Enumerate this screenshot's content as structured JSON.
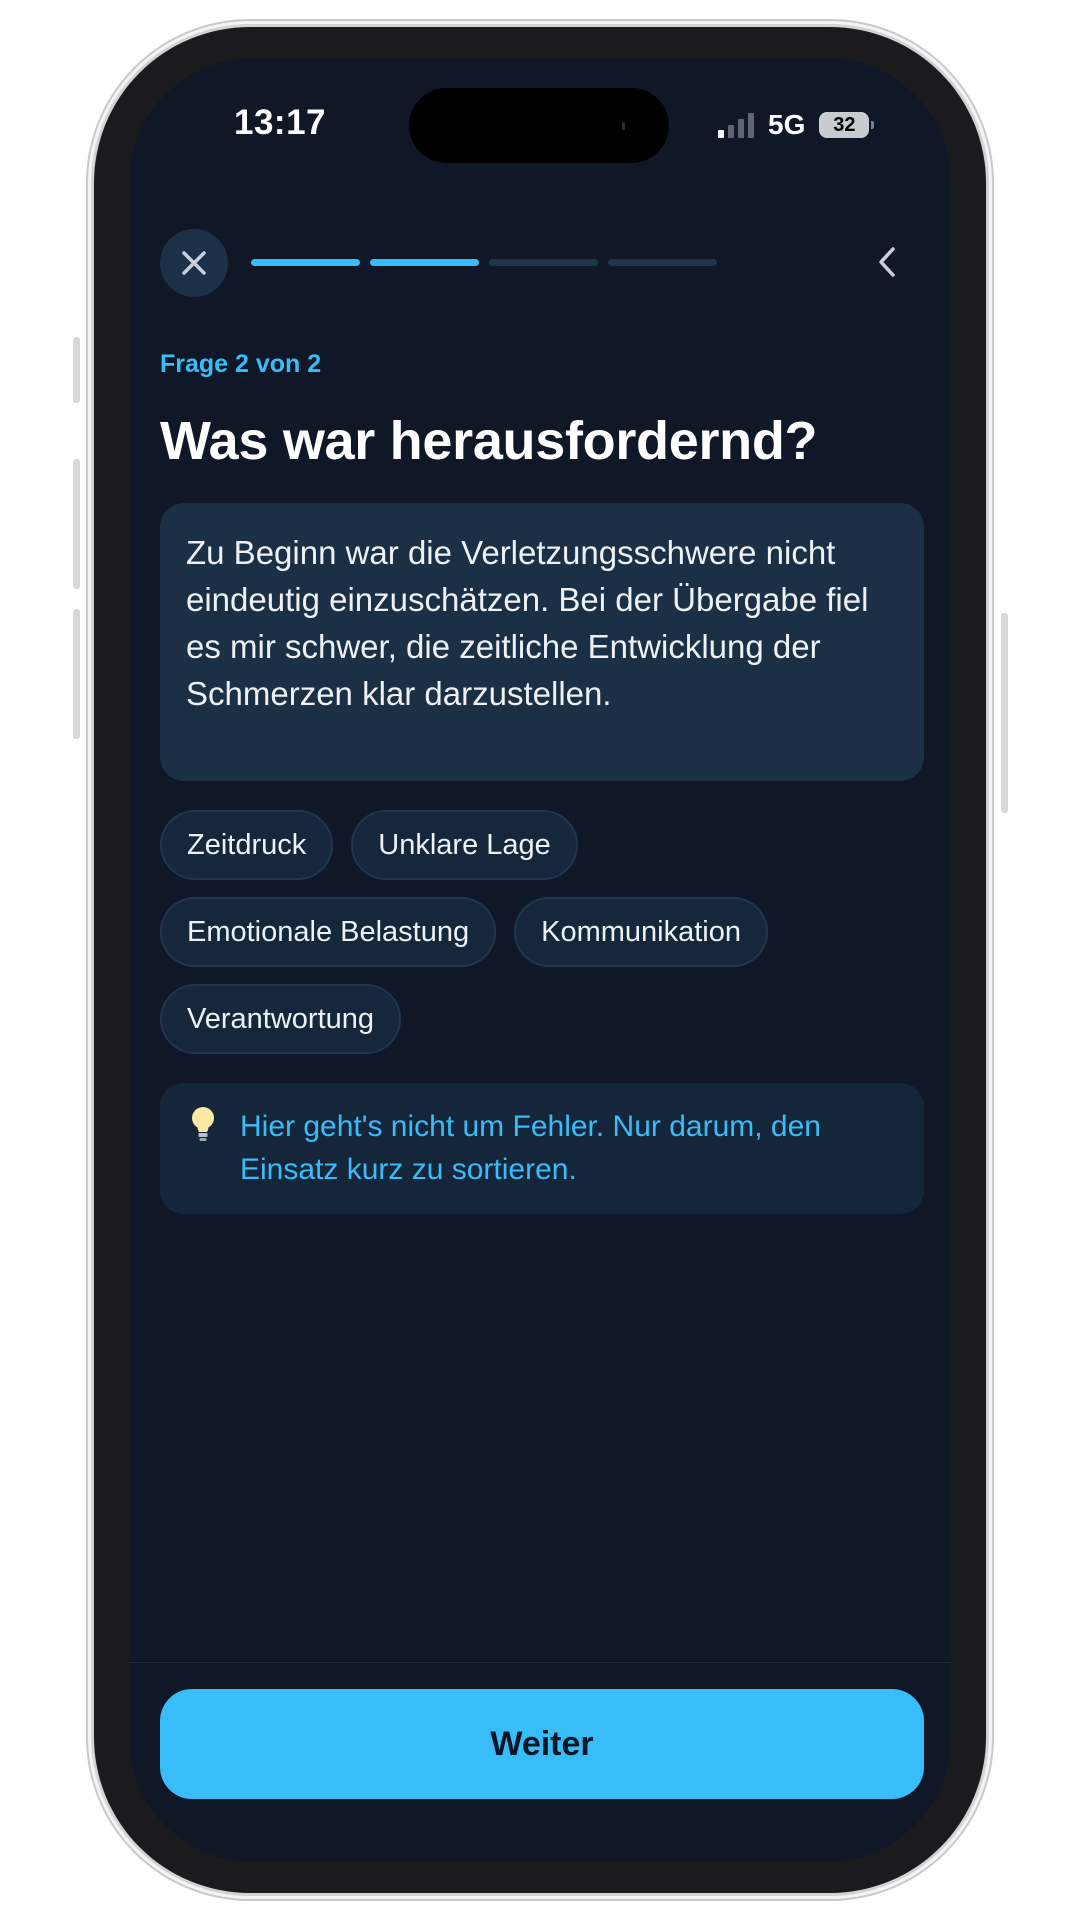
{
  "status_bar": {
    "time": "13:17",
    "network": "5G",
    "battery": "32"
  },
  "header": {
    "progress": {
      "total_segments": 4,
      "completed_segments": 2
    }
  },
  "question": {
    "step_label": "Frage 2 von 2",
    "title": "Was war herausfordernd?",
    "answer_text": "Zu Beginn war die Verletzungsschwere nicht eindeutig einzuschätzen. Bei der Übergabe fiel es mir schwer, die zeitliche Entwicklung der Schmerzen klar darzustellen."
  },
  "chips": [
    {
      "label": "Zeitdruck"
    },
    {
      "label": "Unklare Lage"
    },
    {
      "label": "Emotionale Belastung"
    },
    {
      "label": "Kommunikation"
    },
    {
      "label": "Verantwortung"
    }
  ],
  "hint": {
    "icon": "lightbulb-icon",
    "text": "Hier geht's nicht um Fehler. Nur darum, den Einsatz kurz zu sortieren."
  },
  "footer": {
    "continue_label": "Weiter"
  },
  "colors": {
    "background": "#101828",
    "accent": "#38bdf8",
    "card": "#1b2f45",
    "chip": "#16273b"
  }
}
